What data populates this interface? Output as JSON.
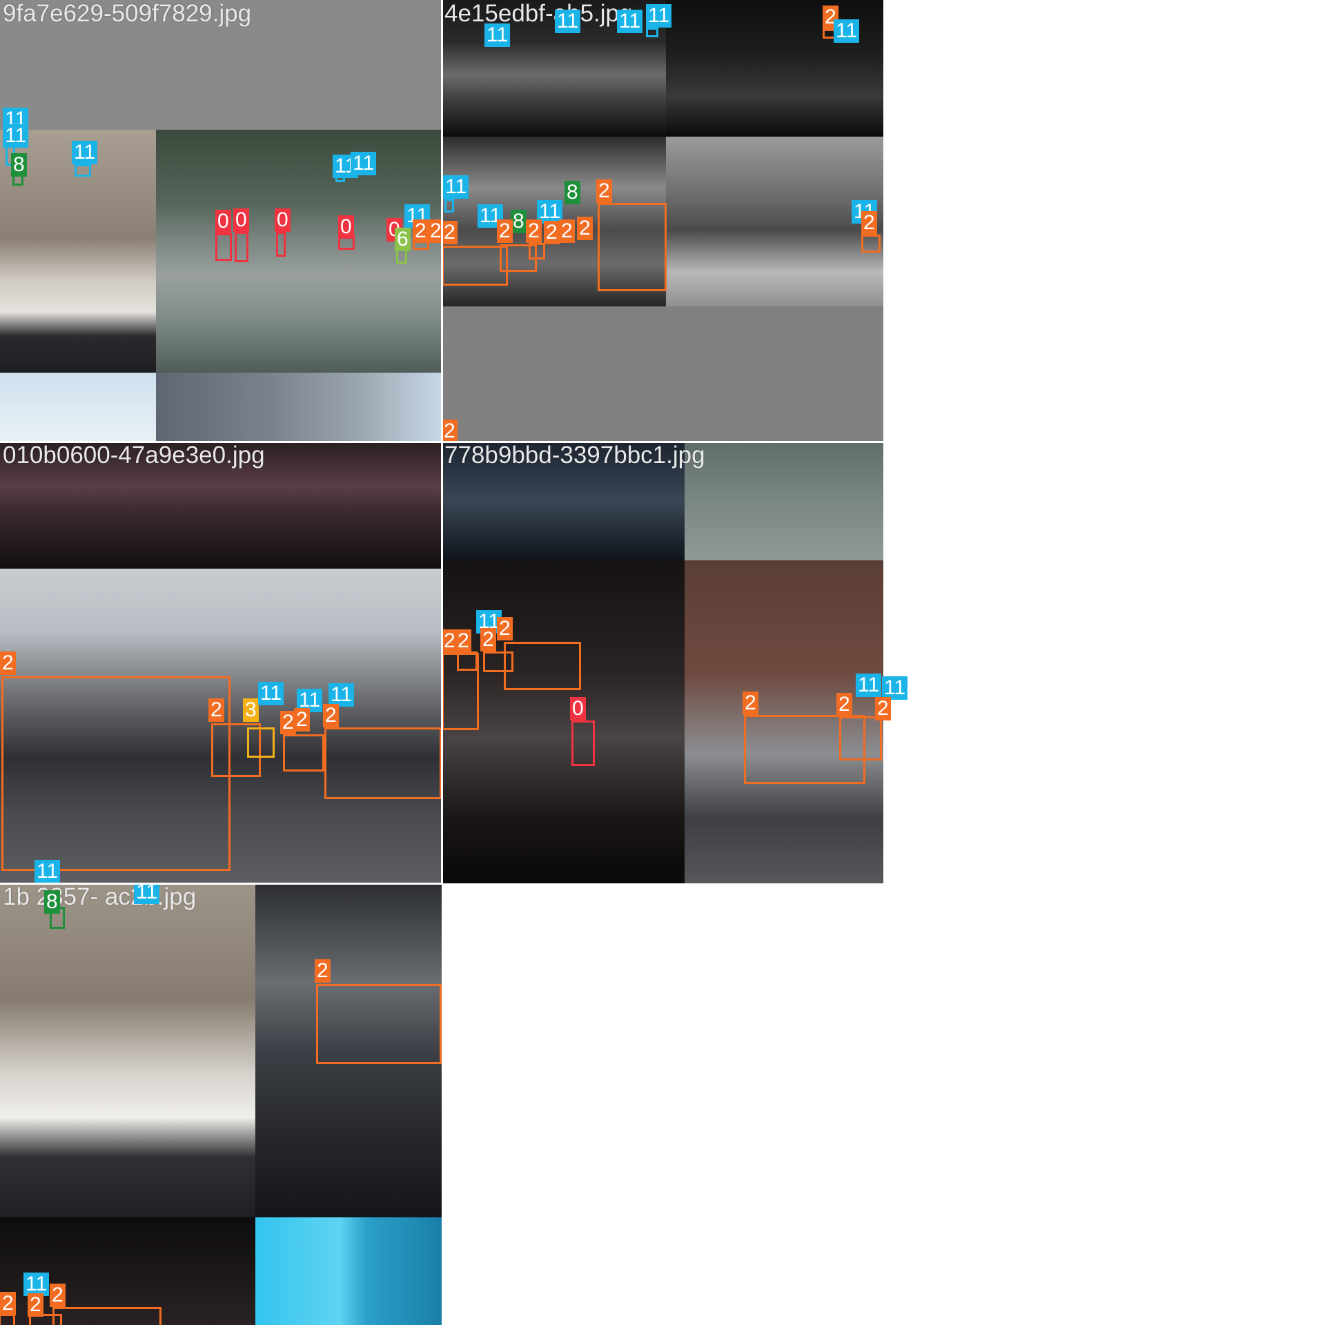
{
  "colors": {
    "class_0": "#ef3340",
    "class_2": "#f26c22",
    "class_3": "#f5b216",
    "class_6": "#8bc34a",
    "class_8": "#1e8f3a",
    "class_11": "#1ab4e8"
  },
  "tiles": [
    {
      "filename": "9fa7e629-509f7829.jpg",
      "detections": [
        {
          "class": "11"
        },
        {
          "class": "11"
        },
        {
          "class": "8"
        },
        {
          "class": "11"
        },
        {
          "class": "11"
        },
        {
          "class": "11"
        },
        {
          "class": "0"
        },
        {
          "class": "0"
        },
        {
          "class": "0"
        },
        {
          "class": "0"
        },
        {
          "class": "0"
        },
        {
          "class": "6"
        },
        {
          "class": "11"
        },
        {
          "class": "2"
        },
        {
          "class": "2"
        }
      ]
    },
    {
      "filename": "4e15edbf-ab5.jpg",
      "detections": [
        {
          "class": "11"
        },
        {
          "class": "11"
        },
        {
          "class": "11"
        },
        {
          "class": "11"
        },
        {
          "class": "2"
        },
        {
          "class": "11"
        },
        {
          "class": "11"
        },
        {
          "class": "8"
        },
        {
          "class": "2"
        },
        {
          "class": "11"
        },
        {
          "class": "8"
        },
        {
          "class": "11"
        },
        {
          "class": "2"
        },
        {
          "class": "2"
        },
        {
          "class": "2"
        },
        {
          "class": "2"
        },
        {
          "class": "2"
        },
        {
          "class": "2"
        },
        {
          "class": "11"
        },
        {
          "class": "2"
        },
        {
          "class": "2"
        }
      ]
    },
    {
      "filename": "010b0600-47a9e3e0.jpg",
      "detections": [
        {
          "class": "2"
        },
        {
          "class": "2"
        },
        {
          "class": "3"
        },
        {
          "class": "11"
        },
        {
          "class": "11"
        },
        {
          "class": "11"
        },
        {
          "class": "2"
        },
        {
          "class": "2"
        },
        {
          "class": "2"
        },
        {
          "class": "11"
        }
      ]
    },
    {
      "filename": "778b9bbd-3397bbc1.jpg",
      "detections": [
        {
          "class": "2"
        },
        {
          "class": "2"
        },
        {
          "class": "11"
        },
        {
          "class": "2"
        },
        {
          "class": "2"
        },
        {
          "class": "0"
        },
        {
          "class": "2"
        },
        {
          "class": "2"
        },
        {
          "class": "11"
        },
        {
          "class": "11"
        },
        {
          "class": "2"
        }
      ]
    },
    {
      "filename": "1b  2357-    ac2b.jpg",
      "detections": [
        {
          "class": "11"
        },
        {
          "class": "8"
        },
        {
          "class": "11"
        },
        {
          "class": "2"
        },
        {
          "class": "11"
        },
        {
          "class": "2"
        },
        {
          "class": "2"
        },
        {
          "class": "2"
        }
      ]
    }
  ]
}
